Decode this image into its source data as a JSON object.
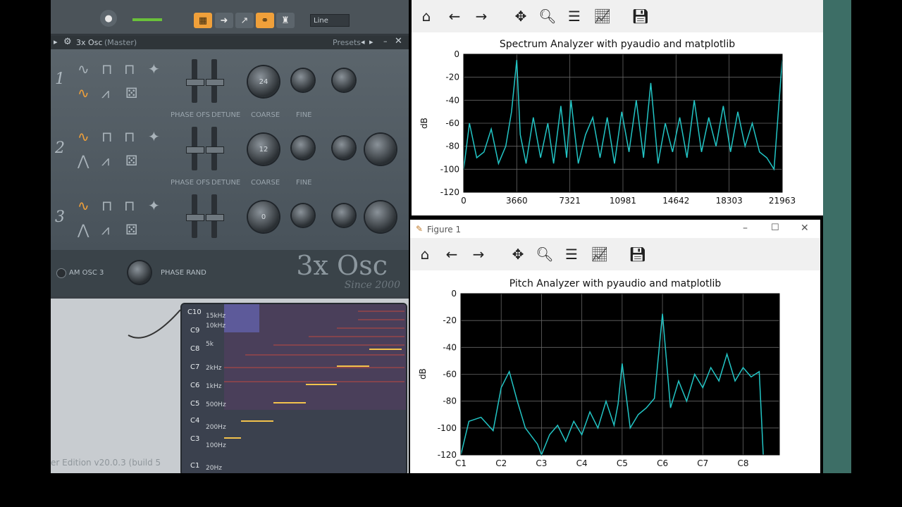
{
  "fl": {
    "toolbar": {
      "line_select": "Line"
    },
    "osc": {
      "title": "3x Osc",
      "title_suffix": "(Master)",
      "presets": "Presets",
      "oscillators": [
        {
          "num": "1",
          "coarse": "24"
        },
        {
          "num": "2",
          "coarse": "12"
        },
        {
          "num": "3",
          "coarse": "0"
        }
      ],
      "labels": {
        "phase_ofs": "PHASE OFS",
        "detune": "DETUNE",
        "coarse": "COARSE",
        "fine": "FINE"
      },
      "am_osc": "AM OSC 3",
      "phase_rand": "PHASE RAND",
      "logo": "3x Osc",
      "since": "Since 2000"
    },
    "edition": "er Edition v20.0.3 (build 5",
    "pitchmap": {
      "notes": [
        "C10",
        "C9",
        "C8",
        "C7",
        "C6",
        "C5",
        "C4",
        "C3",
        "C1"
      ],
      "freqs": [
        "15kHz",
        "10kHz",
        "5k",
        "2kHz",
        "1kHz",
        "500Hz",
        "200Hz",
        "100Hz",
        "20Hz"
      ]
    }
  },
  "spectrum": {
    "title": "Spectrum Analyzer with pyaudio and matplotlib",
    "ylabel": "dB",
    "xticks": [
      "0",
      "3660",
      "7321",
      "10981",
      "14642",
      "18303",
      "21963"
    ],
    "yticks": [
      "0",
      "-20",
      "-40",
      "-60",
      "-80",
      "-100",
      "-120"
    ]
  },
  "pitch": {
    "window_title": "Figure 1",
    "title": "Pitch Analyzer with pyaudio and matplotlib",
    "ylabel": "dB",
    "xticks": [
      "C1",
      "C2",
      "C3",
      "C4",
      "C5",
      "C6",
      "C7",
      "C8"
    ],
    "yticks": [
      "0",
      "-20",
      "-40",
      "-60",
      "-80",
      "-100",
      "-120"
    ]
  },
  "colors": {
    "trace": "#22c5c5",
    "fl_accent": "#f0a03a"
  },
  "chart_data": [
    {
      "type": "line",
      "title": "Spectrum Analyzer with pyaudio and matplotlib",
      "xlabel": "",
      "ylabel": "dB",
      "xlim": [
        0,
        21963
      ],
      "ylim": [
        -120,
        0
      ],
      "grid": true,
      "x": [
        0,
        400,
        900,
        1400,
        1900,
        2400,
        2900,
        3300,
        3660,
        3900,
        4300,
        4800,
        5300,
        5800,
        6200,
        6700,
        7100,
        7400,
        7900,
        8400,
        8900,
        9400,
        9900,
        10400,
        10900,
        11400,
        11900,
        12400,
        12900,
        13400,
        13900,
        14400,
        14900,
        15400,
        15900,
        16400,
        16900,
        17400,
        17900,
        18400,
        18900,
        19400,
        19900,
        20400,
        20900,
        21400,
        21963
      ],
      "y": [
        -100,
        -60,
        -90,
        -85,
        -65,
        -95,
        -80,
        -50,
        -5,
        -70,
        -95,
        -55,
        -90,
        -60,
        -95,
        -45,
        -90,
        -40,
        -95,
        -70,
        -55,
        -90,
        -55,
        -95,
        -50,
        -85,
        -40,
        -90,
        -25,
        -95,
        -60,
        -85,
        -55,
        -90,
        -40,
        -85,
        -55,
        -80,
        -45,
        -85,
        -50,
        -80,
        -60,
        -85,
        -90,
        -100,
        -5
      ]
    },
    {
      "type": "line",
      "title": "Pitch Analyzer with pyaudio and matplotlib",
      "xlabel": "",
      "ylabel": "dB",
      "categories": [
        "C1",
        "C2",
        "C3",
        "C4",
        "C5",
        "C6",
        "C7",
        "C8"
      ],
      "ylim": [
        -120,
        0
      ],
      "grid": true,
      "x": [
        1.0,
        1.2,
        1.5,
        1.8,
        2.0,
        2.2,
        2.4,
        2.6,
        2.9,
        3.0,
        3.2,
        3.4,
        3.6,
        3.8,
        4.0,
        4.2,
        4.4,
        4.6,
        4.8,
        4.9,
        5.0,
        5.2,
        5.4,
        5.6,
        5.8,
        6.0,
        6.2,
        6.4,
        6.6,
        6.8,
        7.0,
        7.2,
        7.4,
        7.6,
        7.8,
        8.0,
        8.2,
        8.4,
        8.5
      ],
      "y": [
        -120,
        -95,
        -92,
        -102,
        -70,
        -58,
        -80,
        -100,
        -112,
        -122,
        -105,
        -98,
        -110,
        -95,
        -105,
        -88,
        -100,
        -80,
        -98,
        -82,
        -52,
        -100,
        -90,
        -85,
        -78,
        -15,
        -85,
        -65,
        -80,
        -60,
        -70,
        -55,
        -65,
        -45,
        -65,
        -55,
        -62,
        -58,
        -120
      ]
    }
  ]
}
